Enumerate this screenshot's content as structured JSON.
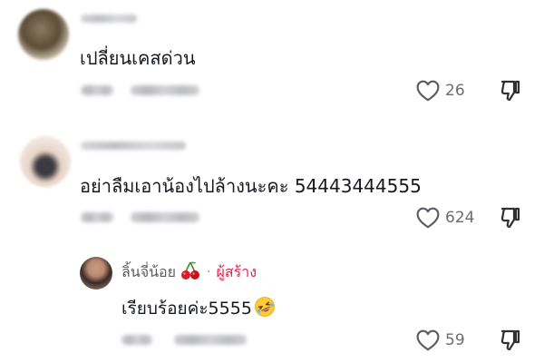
{
  "comments": [
    {
      "text": "เปลี่ยนเคสด่วน",
      "likes": "26"
    },
    {
      "text": "อย่าลืมเอาน้องไปล้างนะคะ 54443444555",
      "likes": "624",
      "reply": {
        "author": "ลิ้นจี่น้อย",
        "author_badge": "ผู้สร้าง",
        "separator": "·",
        "text": "เรียบร้อยค่ะ5555",
        "likes": "59"
      }
    }
  ],
  "icons": {
    "like": "heart-outline-icon",
    "dislike": "thumbs-down-icon",
    "cherry": "cherry-emoji-icon",
    "laugh": "rolling-on-floor-laughing-emoji-icon"
  },
  "colors": {
    "text": "#161823",
    "meta": "#6b6c73",
    "creator_badge": "#e2214a"
  }
}
